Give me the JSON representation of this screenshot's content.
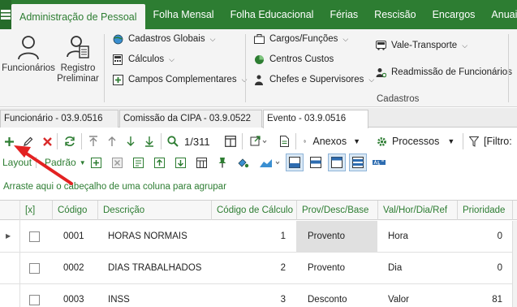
{
  "ribbon": {
    "tabs": [
      "Administração de Pessoal",
      "Folha Mensal",
      "Folha Educacional",
      "Férias",
      "Rescisão",
      "Encargos",
      "Anuais"
    ],
    "active_tab": "Administração de Pessoal",
    "big_buttons": [
      {
        "label": "Funcionários"
      },
      {
        "label": "Registro Preliminar"
      }
    ],
    "group1": [
      "Cadastros Globais",
      "Cálculos",
      "Campos Complementares"
    ],
    "group2": [
      "Cargos/Funções",
      "Centros Custos",
      "Chefes e Supervisores"
    ],
    "group3": [
      "Vale-Transporte",
      "Readmissão de Funcionários"
    ],
    "group_label": "Cadastros"
  },
  "doc_tabs": [
    "Funcionário - 03.9.0516",
    "Comissão da CIPA - 03.9.0522",
    "Evento - 03.9.0516"
  ],
  "toolbar": {
    "record_counter": "1/311",
    "anexos": "Anexos",
    "processos": "Processos",
    "filtro": "[Filtro:",
    "layout": "Layout",
    "padrao": "Padrão"
  },
  "group_hint": "Arraste aqui o cabeçalho de uma coluna para agrupar",
  "grid": {
    "headers": [
      "[x]",
      "Código",
      "Descrição",
      "Código de Cálculo",
      "Prov/Desc/Base",
      "Val/Hor/Dia/Ref",
      "Prioridade"
    ],
    "rows": [
      {
        "codigo": "0001",
        "descricao": "HORAS NORMAIS",
        "calc": "1",
        "tipo": "Provento",
        "valor": "Hora",
        "prioridade": "0"
      },
      {
        "codigo": "0002",
        "descricao": "DIAS TRABALHADOS",
        "calc": "2",
        "tipo": "Provento",
        "valor": "Dia",
        "prioridade": "0"
      },
      {
        "codigo": "0003",
        "descricao": "INSS",
        "calc": "3",
        "tipo": "Desconto",
        "valor": "Valor",
        "prioridade": "81"
      }
    ]
  },
  "colors": {
    "brand": "#2d7d32",
    "arrow": "#e32222"
  }
}
